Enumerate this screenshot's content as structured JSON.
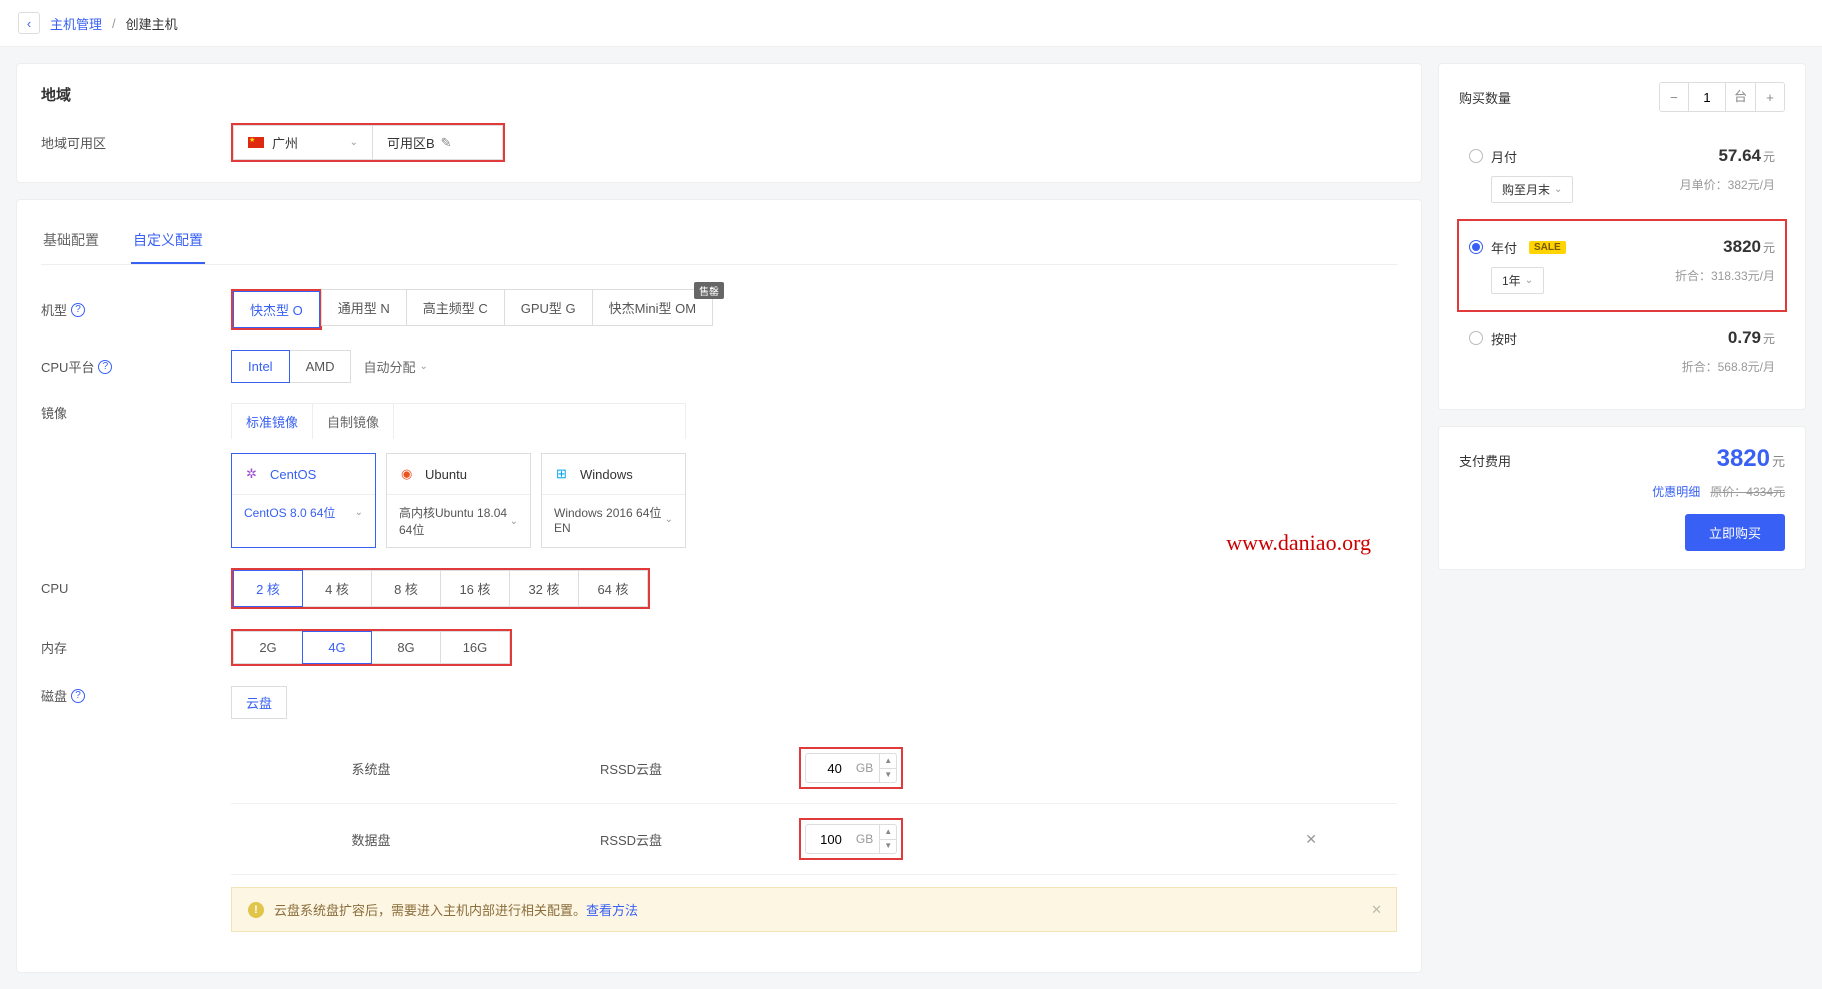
{
  "breadcrumb": {
    "parent": "主机管理",
    "sep": "/",
    "current": "创建主机"
  },
  "region": {
    "title": "地域",
    "label": "地域可用区",
    "city": "广州",
    "zone": "可用区B"
  },
  "tabs": {
    "basic": "基础配置",
    "custom": "自定义配置"
  },
  "model": {
    "label": "机型",
    "opts": [
      "快杰型 O",
      "通用型 N",
      "高主频型 C",
      "GPU型 G",
      "快杰Mini型 OM"
    ],
    "badge": "售罄"
  },
  "cpu_platform": {
    "label": "CPU平台",
    "opts": [
      "Intel",
      "AMD"
    ],
    "auto": "自动分配"
  },
  "image": {
    "label": "镜像",
    "tabs": [
      "标准镜像",
      "自制镜像"
    ],
    "os": [
      {
        "name": "CentOS",
        "ver": "CentOS 8.0 64位"
      },
      {
        "name": "Ubuntu",
        "ver": "高内核Ubuntu 18.04 64位"
      },
      {
        "name": "Windows",
        "ver": "Windows 2016 64位 EN"
      }
    ]
  },
  "cpu": {
    "label": "CPU",
    "opts": [
      "2 核",
      "4 核",
      "8 核",
      "16 核",
      "32 核",
      "64 核"
    ]
  },
  "mem": {
    "label": "内存",
    "opts": [
      "2G",
      "4G",
      "8G",
      "16G"
    ]
  },
  "disk": {
    "label": "磁盘",
    "tab": "云盘",
    "rows": [
      {
        "name": "系统盘",
        "type": "RSSD云盘",
        "size": "40",
        "unit": "GB"
      },
      {
        "name": "数据盘",
        "type": "RSSD云盘",
        "size": "100",
        "unit": "GB",
        "removable": true
      }
    ],
    "alert": {
      "text": "云盘系统盘扩容后，需要进入主机内部进行相关配置。",
      "link": "查看方法"
    }
  },
  "purchase": {
    "qty_label": "购买数量",
    "qty": "1",
    "qty_unit": "台",
    "monthly": {
      "label": "月付",
      "price": "57.64",
      "sub_sel": "购至月末",
      "sub_r": "月单价：382元/月"
    },
    "yearly": {
      "label": "年付",
      "sale": "SALE",
      "price": "3820",
      "sub_sel": "1年",
      "sub_r": "折合：318.33元/月"
    },
    "hourly": {
      "label": "按时",
      "price": "0.79",
      "sub_r": "折合：568.8元/月"
    },
    "currency": "元"
  },
  "total": {
    "label": "支付费用",
    "amount": "3820",
    "currency": "元",
    "detail": "优惠明细",
    "orig": "原价：4334元",
    "buy": "立即购买"
  },
  "watermark": "www.daniao.org"
}
